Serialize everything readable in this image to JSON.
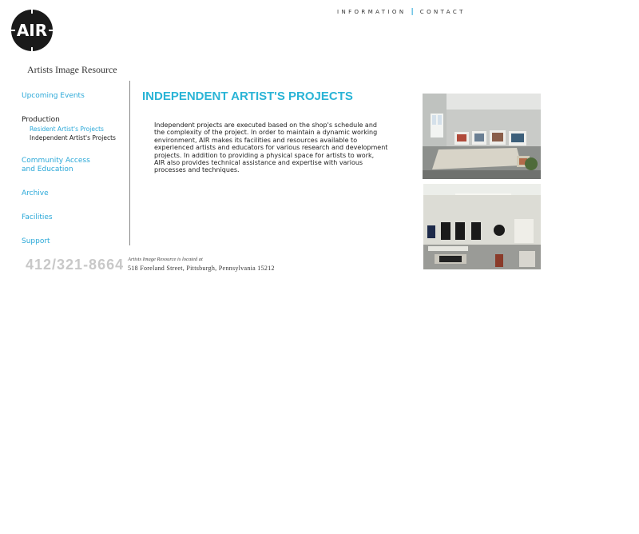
{
  "brand": {
    "logo_text": "AIR",
    "org_name": "Artists Image Resource"
  },
  "top_nav": {
    "information": "INFORMATION",
    "separator": "|",
    "contact": "CONTACT"
  },
  "sidebar": {
    "upcoming_events": "Upcoming Events",
    "production": "Production",
    "resident_projects": "Resident Artist's Projects",
    "independent_projects": "Independent Artist's Projects",
    "community_access_1": "Community Access",
    "community_access_2": "and Education",
    "archive": "Archive",
    "facilities": "Facilities",
    "support": "Support"
  },
  "main": {
    "title": "INDEPENDENT ARTIST'S PROJECTS",
    "body_lines": [
      "Independent projects are executed based on the shop's schedule and",
      "the complexity of the project. In order to maintain a dynamic working",
      "environment, AIR makes its facilities and resources available to",
      "experienced artists and educators for various research and development",
      "projects. In addition to providing a physical space for artists to work,",
      "AIR also provides technical assistance and expertise with various",
      "processes and techniques."
    ]
  },
  "footer": {
    "phone": "412/321-8664",
    "address_intro": "Artists Image Resource is located at",
    "address": "518 Foreland Street, Pittsburgh, Pennsylvania 15212"
  },
  "colors": {
    "accent": "#2aa8d8",
    "title": "#2ab4d6",
    "phone": "#c8c8c8"
  }
}
